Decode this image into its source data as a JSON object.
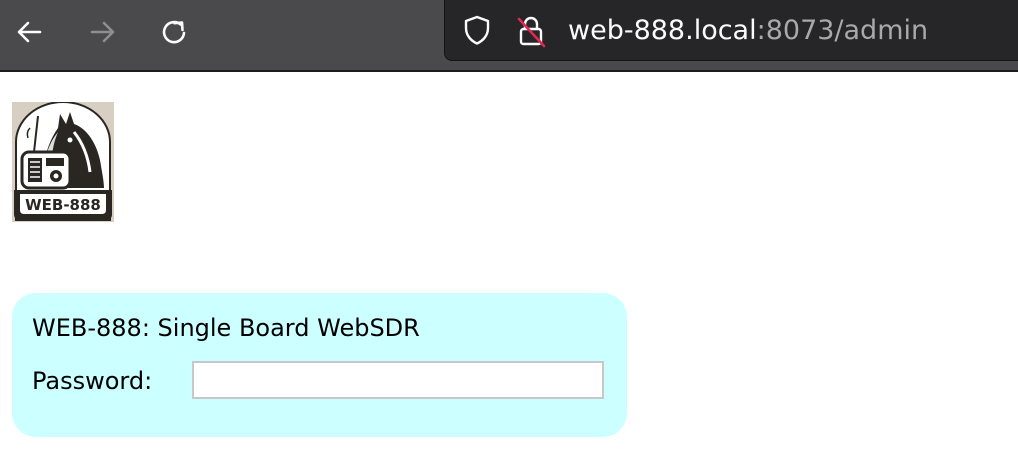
{
  "browser": {
    "back_icon": "arrow-left-icon",
    "forward_icon": "arrow-right-icon",
    "reload_icon": "reload-icon",
    "url_host": "web-888.local",
    "url_rest": ":8073/admin",
    "colors": {
      "toolbar": "#4a4a4c",
      "urlbar": "#262628",
      "url_text": "#fbfbfe",
      "url_dim": "#a8a8ad"
    }
  },
  "logo": {
    "text": "WEB-888"
  },
  "login": {
    "title": "WEB-888: Single Board WebSDR",
    "password_label": "Password:",
    "password_value": "",
    "background": "#ccffff"
  }
}
